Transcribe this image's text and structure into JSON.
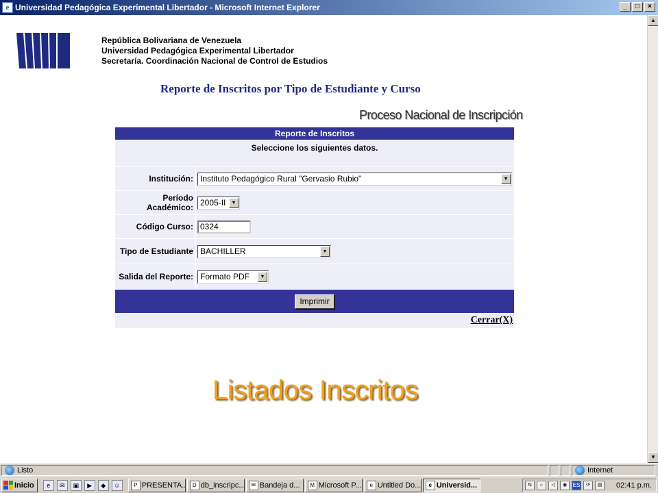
{
  "window": {
    "title": "Universidad Pedagógica Experimental Libertador - Microsoft Internet Explorer",
    "minimize": "_",
    "maximize": "□",
    "close": "×"
  },
  "header": {
    "line1": "República Bolivariana de Venezuela",
    "line2": "Universidad Pedagógica Experimental Libertador",
    "line3": "Secretaría. Coordinación Nacional de Control de Estudios"
  },
  "report_title": "Reporte de Inscritos por Tipo de Estudiante y Curso",
  "process_title": "Proceso Nacional de Inscripción",
  "form": {
    "heading": "Reporte de Inscritos",
    "instruction": "Seleccione los siguientes datos.",
    "institucion_label": "Institución:",
    "institucion_value": "Instituto Pedagógico Rural \"Gervasio Rubio\"",
    "periodo_label_1": "Período",
    "periodo_label_2": "Académico:",
    "periodo_value": "2005-II",
    "codigo_label": "Código Curso:",
    "codigo_value": "0324",
    "tipo_label": "Tipo de Estudiante",
    "tipo_value": "BACHILLER",
    "salida_label": "Salida del Reporte:",
    "salida_value": "Formato PDF",
    "print_button": "Imprimir",
    "close_link": "Cerrar(X)"
  },
  "slide_title": "Listados Inscritos",
  "status": {
    "text": "Listo",
    "zone": "Internet"
  },
  "taskbar": {
    "start": "Inicio",
    "tasks": [
      {
        "label": "PRESENTA..."
      },
      {
        "label": "db_inscripc..."
      },
      {
        "label": "Bandeja d..."
      },
      {
        "label": "Microsoft P..."
      },
      {
        "label": "Untitled Do..."
      },
      {
        "label": "Universid..."
      }
    ],
    "tray_lang": "ES",
    "clock": "02:41 p.m."
  },
  "colors": {
    "accent": "#333399",
    "title_blue": "#1f2a80",
    "slide_title": "#f0a020"
  }
}
